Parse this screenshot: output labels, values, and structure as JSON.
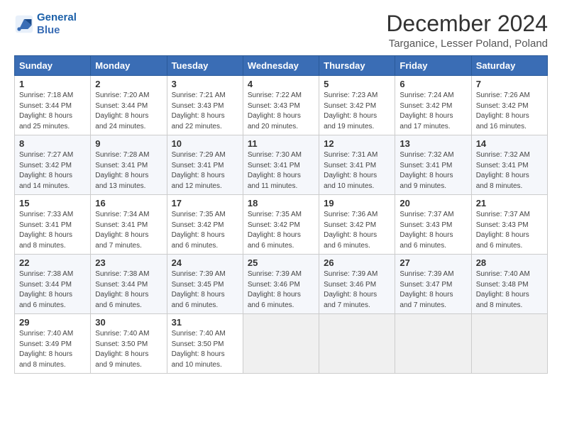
{
  "logo": {
    "line1": "General",
    "line2": "Blue"
  },
  "title": "December 2024",
  "subtitle": "Targanice, Lesser Poland, Poland",
  "header": {
    "days": [
      "Sunday",
      "Monday",
      "Tuesday",
      "Wednesday",
      "Thursday",
      "Friday",
      "Saturday"
    ]
  },
  "weeks": [
    [
      {
        "num": "1",
        "rise": "7:18 AM",
        "set": "3:44 PM",
        "daylight": "8 hours and 25 minutes."
      },
      {
        "num": "2",
        "rise": "7:20 AM",
        "set": "3:44 PM",
        "daylight": "8 hours and 24 minutes."
      },
      {
        "num": "3",
        "rise": "7:21 AM",
        "set": "3:43 PM",
        "daylight": "8 hours and 22 minutes."
      },
      {
        "num": "4",
        "rise": "7:22 AM",
        "set": "3:43 PM",
        "daylight": "8 hours and 20 minutes."
      },
      {
        "num": "5",
        "rise": "7:23 AM",
        "set": "3:42 PM",
        "daylight": "8 hours and 19 minutes."
      },
      {
        "num": "6",
        "rise": "7:24 AM",
        "set": "3:42 PM",
        "daylight": "8 hours and 17 minutes."
      },
      {
        "num": "7",
        "rise": "7:26 AM",
        "set": "3:42 PM",
        "daylight": "8 hours and 16 minutes."
      }
    ],
    [
      {
        "num": "8",
        "rise": "7:27 AM",
        "set": "3:42 PM",
        "daylight": "8 hours and 14 minutes."
      },
      {
        "num": "9",
        "rise": "7:28 AM",
        "set": "3:41 PM",
        "daylight": "8 hours and 13 minutes."
      },
      {
        "num": "10",
        "rise": "7:29 AM",
        "set": "3:41 PM",
        "daylight": "8 hours and 12 minutes."
      },
      {
        "num": "11",
        "rise": "7:30 AM",
        "set": "3:41 PM",
        "daylight": "8 hours and 11 minutes."
      },
      {
        "num": "12",
        "rise": "7:31 AM",
        "set": "3:41 PM",
        "daylight": "8 hours and 10 minutes."
      },
      {
        "num": "13",
        "rise": "7:32 AM",
        "set": "3:41 PM",
        "daylight": "8 hours and 9 minutes."
      },
      {
        "num": "14",
        "rise": "7:32 AM",
        "set": "3:41 PM",
        "daylight": "8 hours and 8 minutes."
      }
    ],
    [
      {
        "num": "15",
        "rise": "7:33 AM",
        "set": "3:41 PM",
        "daylight": "8 hours and 8 minutes."
      },
      {
        "num": "16",
        "rise": "7:34 AM",
        "set": "3:41 PM",
        "daylight": "8 hours and 7 minutes."
      },
      {
        "num": "17",
        "rise": "7:35 AM",
        "set": "3:42 PM",
        "daylight": "8 hours and 6 minutes."
      },
      {
        "num": "18",
        "rise": "7:35 AM",
        "set": "3:42 PM",
        "daylight": "8 hours and 6 minutes."
      },
      {
        "num": "19",
        "rise": "7:36 AM",
        "set": "3:42 PM",
        "daylight": "8 hours and 6 minutes."
      },
      {
        "num": "20",
        "rise": "7:37 AM",
        "set": "3:43 PM",
        "daylight": "8 hours and 6 minutes."
      },
      {
        "num": "21",
        "rise": "7:37 AM",
        "set": "3:43 PM",
        "daylight": "8 hours and 6 minutes."
      }
    ],
    [
      {
        "num": "22",
        "rise": "7:38 AM",
        "set": "3:44 PM",
        "daylight": "8 hours and 6 minutes."
      },
      {
        "num": "23",
        "rise": "7:38 AM",
        "set": "3:44 PM",
        "daylight": "8 hours and 6 minutes."
      },
      {
        "num": "24",
        "rise": "7:39 AM",
        "set": "3:45 PM",
        "daylight": "8 hours and 6 minutes."
      },
      {
        "num": "25",
        "rise": "7:39 AM",
        "set": "3:46 PM",
        "daylight": "8 hours and 6 minutes."
      },
      {
        "num": "26",
        "rise": "7:39 AM",
        "set": "3:46 PM",
        "daylight": "8 hours and 7 minutes."
      },
      {
        "num": "27",
        "rise": "7:39 AM",
        "set": "3:47 PM",
        "daylight": "8 hours and 7 minutes."
      },
      {
        "num": "28",
        "rise": "7:40 AM",
        "set": "3:48 PM",
        "daylight": "8 hours and 8 minutes."
      }
    ],
    [
      {
        "num": "29",
        "rise": "7:40 AM",
        "set": "3:49 PM",
        "daylight": "8 hours and 8 minutes."
      },
      {
        "num": "30",
        "rise": "7:40 AM",
        "set": "3:50 PM",
        "daylight": "8 hours and 9 minutes."
      },
      {
        "num": "31",
        "rise": "7:40 AM",
        "set": "3:50 PM",
        "daylight": "8 hours and 10 minutes."
      },
      null,
      null,
      null,
      null
    ]
  ]
}
